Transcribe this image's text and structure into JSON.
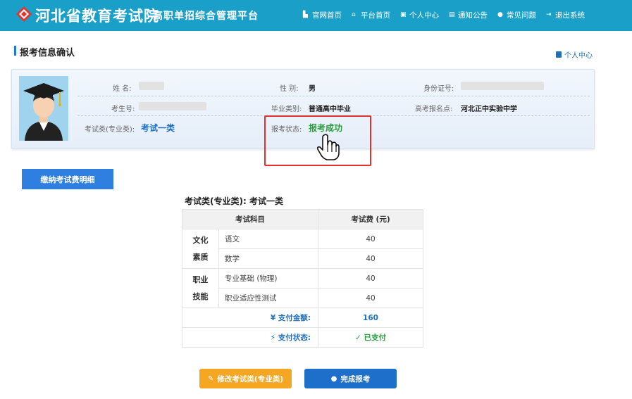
{
  "header": {
    "title": "河北省教育考试院",
    "subtitle": "高职单招综合管理平台",
    "nav": [
      {
        "label": "官网首页",
        "icon": "building-icon"
      },
      {
        "label": "平台首页",
        "icon": "home-icon"
      },
      {
        "label": "个人中心",
        "icon": "user-card-icon"
      },
      {
        "label": "通知公告",
        "icon": "notice-icon"
      },
      {
        "label": "常见问题",
        "icon": "chat-icon"
      },
      {
        "label": "退出系统",
        "icon": "logout-icon"
      }
    ]
  },
  "page": {
    "title": "报考信息确认",
    "personal_link": "个人中心"
  },
  "info": {
    "name_label": "姓 名:",
    "gender_label": "性 别:",
    "gender_value": "男",
    "id_label": "身份证号:",
    "exam_no_label": "考生号:",
    "grad_type_label": "毕业类别:",
    "grad_type_value": "普通高中毕业",
    "exam_site_label": "高考报名点:",
    "exam_site_value": "河北正中实验中学",
    "category_label": "考试类(专业类):",
    "category_value": "考试一类",
    "status_label": "报考状态:",
    "status_value": "报考成功"
  },
  "pay_detail_button": "缴纳考试费明细",
  "fee_table": {
    "title": "考试类(专业类): 考试一类",
    "headers": [
      "考试科目",
      "考试费 (元)"
    ],
    "groups": [
      {
        "category": [
          "文化",
          "素质"
        ],
        "rows": [
          {
            "subject": "语文",
            "fee": "40"
          },
          {
            "subject": "数学",
            "fee": "40"
          }
        ]
      },
      {
        "category": [
          "职业",
          "技能"
        ],
        "rows": [
          {
            "subject": "专业基础 (物理)",
            "fee": "40"
          },
          {
            "subject": "职业适应性测试",
            "fee": "40"
          }
        ]
      }
    ],
    "total_label": "¥ 支付金额:",
    "total_value": "160",
    "pay_status_label": "⚡ 支付状态:",
    "pay_status_value": "✓ 已支付"
  },
  "buttons": {
    "modify": "修改考试类(专业类)",
    "finish": "完成报考"
  },
  "colors": {
    "header_bg": "#1aa0c8",
    "accent_blue": "#1f6fbf",
    "success_green": "#2a9e3e",
    "modify_orange": "#f5a623",
    "highlight_red": "#e03030"
  }
}
